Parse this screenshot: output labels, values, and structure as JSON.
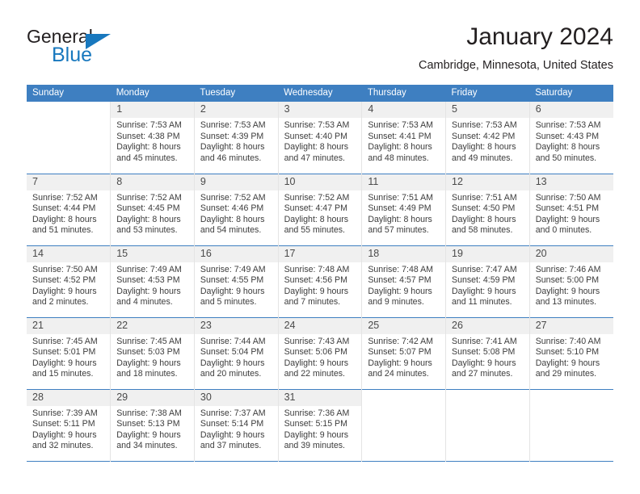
{
  "logo": {
    "word_general": "General",
    "word_blue": "Blue",
    "triangle_color": "#1878be"
  },
  "header": {
    "title": "January 2024",
    "subtitle": "Cambridge, Minnesota, United States"
  },
  "theme": {
    "header_blue": "#3e7fc1",
    "daynum_band": "#f0f0f0",
    "text": "#3c3c3c"
  },
  "weekday_headers": [
    "Sunday",
    "Monday",
    "Tuesday",
    "Wednesday",
    "Thursday",
    "Friday",
    "Saturday"
  ],
  "labels": {
    "sunrise_prefix": "Sunrise:",
    "sunset_prefix": "Sunset:",
    "daylight_prefix": "Daylight:"
  },
  "weeks": [
    [
      {
        "day": "",
        "sunrise": "",
        "sunset": "",
        "daylight": "",
        "blank": true
      },
      {
        "day": "1",
        "sunrise": "Sunrise: 7:53 AM",
        "sunset": "Sunset: 4:38 PM",
        "daylight": "Daylight: 8 hours and 45 minutes."
      },
      {
        "day": "2",
        "sunrise": "Sunrise: 7:53 AM",
        "sunset": "Sunset: 4:39 PM",
        "daylight": "Daylight: 8 hours and 46 minutes."
      },
      {
        "day": "3",
        "sunrise": "Sunrise: 7:53 AM",
        "sunset": "Sunset: 4:40 PM",
        "daylight": "Daylight: 8 hours and 47 minutes."
      },
      {
        "day": "4",
        "sunrise": "Sunrise: 7:53 AM",
        "sunset": "Sunset: 4:41 PM",
        "daylight": "Daylight: 8 hours and 48 minutes."
      },
      {
        "day": "5",
        "sunrise": "Sunrise: 7:53 AM",
        "sunset": "Sunset: 4:42 PM",
        "daylight": "Daylight: 8 hours and 49 minutes."
      },
      {
        "day": "6",
        "sunrise": "Sunrise: 7:53 AM",
        "sunset": "Sunset: 4:43 PM",
        "daylight": "Daylight: 8 hours and 50 minutes."
      }
    ],
    [
      {
        "day": "7",
        "sunrise": "Sunrise: 7:52 AM",
        "sunset": "Sunset: 4:44 PM",
        "daylight": "Daylight: 8 hours and 51 minutes."
      },
      {
        "day": "8",
        "sunrise": "Sunrise: 7:52 AM",
        "sunset": "Sunset: 4:45 PM",
        "daylight": "Daylight: 8 hours and 53 minutes."
      },
      {
        "day": "9",
        "sunrise": "Sunrise: 7:52 AM",
        "sunset": "Sunset: 4:46 PM",
        "daylight": "Daylight: 8 hours and 54 minutes."
      },
      {
        "day": "10",
        "sunrise": "Sunrise: 7:52 AM",
        "sunset": "Sunset: 4:47 PM",
        "daylight": "Daylight: 8 hours and 55 minutes."
      },
      {
        "day": "11",
        "sunrise": "Sunrise: 7:51 AM",
        "sunset": "Sunset: 4:49 PM",
        "daylight": "Daylight: 8 hours and 57 minutes."
      },
      {
        "day": "12",
        "sunrise": "Sunrise: 7:51 AM",
        "sunset": "Sunset: 4:50 PM",
        "daylight": "Daylight: 8 hours and 58 minutes."
      },
      {
        "day": "13",
        "sunrise": "Sunrise: 7:50 AM",
        "sunset": "Sunset: 4:51 PM",
        "daylight": "Daylight: 9 hours and 0 minutes."
      }
    ],
    [
      {
        "day": "14",
        "sunrise": "Sunrise: 7:50 AM",
        "sunset": "Sunset: 4:52 PM",
        "daylight": "Daylight: 9 hours and 2 minutes."
      },
      {
        "day": "15",
        "sunrise": "Sunrise: 7:49 AM",
        "sunset": "Sunset: 4:53 PM",
        "daylight": "Daylight: 9 hours and 4 minutes."
      },
      {
        "day": "16",
        "sunrise": "Sunrise: 7:49 AM",
        "sunset": "Sunset: 4:55 PM",
        "daylight": "Daylight: 9 hours and 5 minutes."
      },
      {
        "day": "17",
        "sunrise": "Sunrise: 7:48 AM",
        "sunset": "Sunset: 4:56 PM",
        "daylight": "Daylight: 9 hours and 7 minutes."
      },
      {
        "day": "18",
        "sunrise": "Sunrise: 7:48 AM",
        "sunset": "Sunset: 4:57 PM",
        "daylight": "Daylight: 9 hours and 9 minutes."
      },
      {
        "day": "19",
        "sunrise": "Sunrise: 7:47 AM",
        "sunset": "Sunset: 4:59 PM",
        "daylight": "Daylight: 9 hours and 11 minutes."
      },
      {
        "day": "20",
        "sunrise": "Sunrise: 7:46 AM",
        "sunset": "Sunset: 5:00 PM",
        "daylight": "Daylight: 9 hours and 13 minutes."
      }
    ],
    [
      {
        "day": "21",
        "sunrise": "Sunrise: 7:45 AM",
        "sunset": "Sunset: 5:01 PM",
        "daylight": "Daylight: 9 hours and 15 minutes."
      },
      {
        "day": "22",
        "sunrise": "Sunrise: 7:45 AM",
        "sunset": "Sunset: 5:03 PM",
        "daylight": "Daylight: 9 hours and 18 minutes."
      },
      {
        "day": "23",
        "sunrise": "Sunrise: 7:44 AM",
        "sunset": "Sunset: 5:04 PM",
        "daylight": "Daylight: 9 hours and 20 minutes."
      },
      {
        "day": "24",
        "sunrise": "Sunrise: 7:43 AM",
        "sunset": "Sunset: 5:06 PM",
        "daylight": "Daylight: 9 hours and 22 minutes."
      },
      {
        "day": "25",
        "sunrise": "Sunrise: 7:42 AM",
        "sunset": "Sunset: 5:07 PM",
        "daylight": "Daylight: 9 hours and 24 minutes."
      },
      {
        "day": "26",
        "sunrise": "Sunrise: 7:41 AM",
        "sunset": "Sunset: 5:08 PM",
        "daylight": "Daylight: 9 hours and 27 minutes."
      },
      {
        "day": "27",
        "sunrise": "Sunrise: 7:40 AM",
        "sunset": "Sunset: 5:10 PM",
        "daylight": "Daylight: 9 hours and 29 minutes."
      }
    ],
    [
      {
        "day": "28",
        "sunrise": "Sunrise: 7:39 AM",
        "sunset": "Sunset: 5:11 PM",
        "daylight": "Daylight: 9 hours and 32 minutes."
      },
      {
        "day": "29",
        "sunrise": "Sunrise: 7:38 AM",
        "sunset": "Sunset: 5:13 PM",
        "daylight": "Daylight: 9 hours and 34 minutes."
      },
      {
        "day": "30",
        "sunrise": "Sunrise: 7:37 AM",
        "sunset": "Sunset: 5:14 PM",
        "daylight": "Daylight: 9 hours and 37 minutes."
      },
      {
        "day": "31",
        "sunrise": "Sunrise: 7:36 AM",
        "sunset": "Sunset: 5:15 PM",
        "daylight": "Daylight: 9 hours and 39 minutes."
      },
      {
        "day": "",
        "sunrise": "",
        "sunset": "",
        "daylight": "",
        "blank": true
      },
      {
        "day": "",
        "sunrise": "",
        "sunset": "",
        "daylight": "",
        "blank": true
      },
      {
        "day": "",
        "sunrise": "",
        "sunset": "",
        "daylight": "",
        "blank": true
      }
    ]
  ]
}
